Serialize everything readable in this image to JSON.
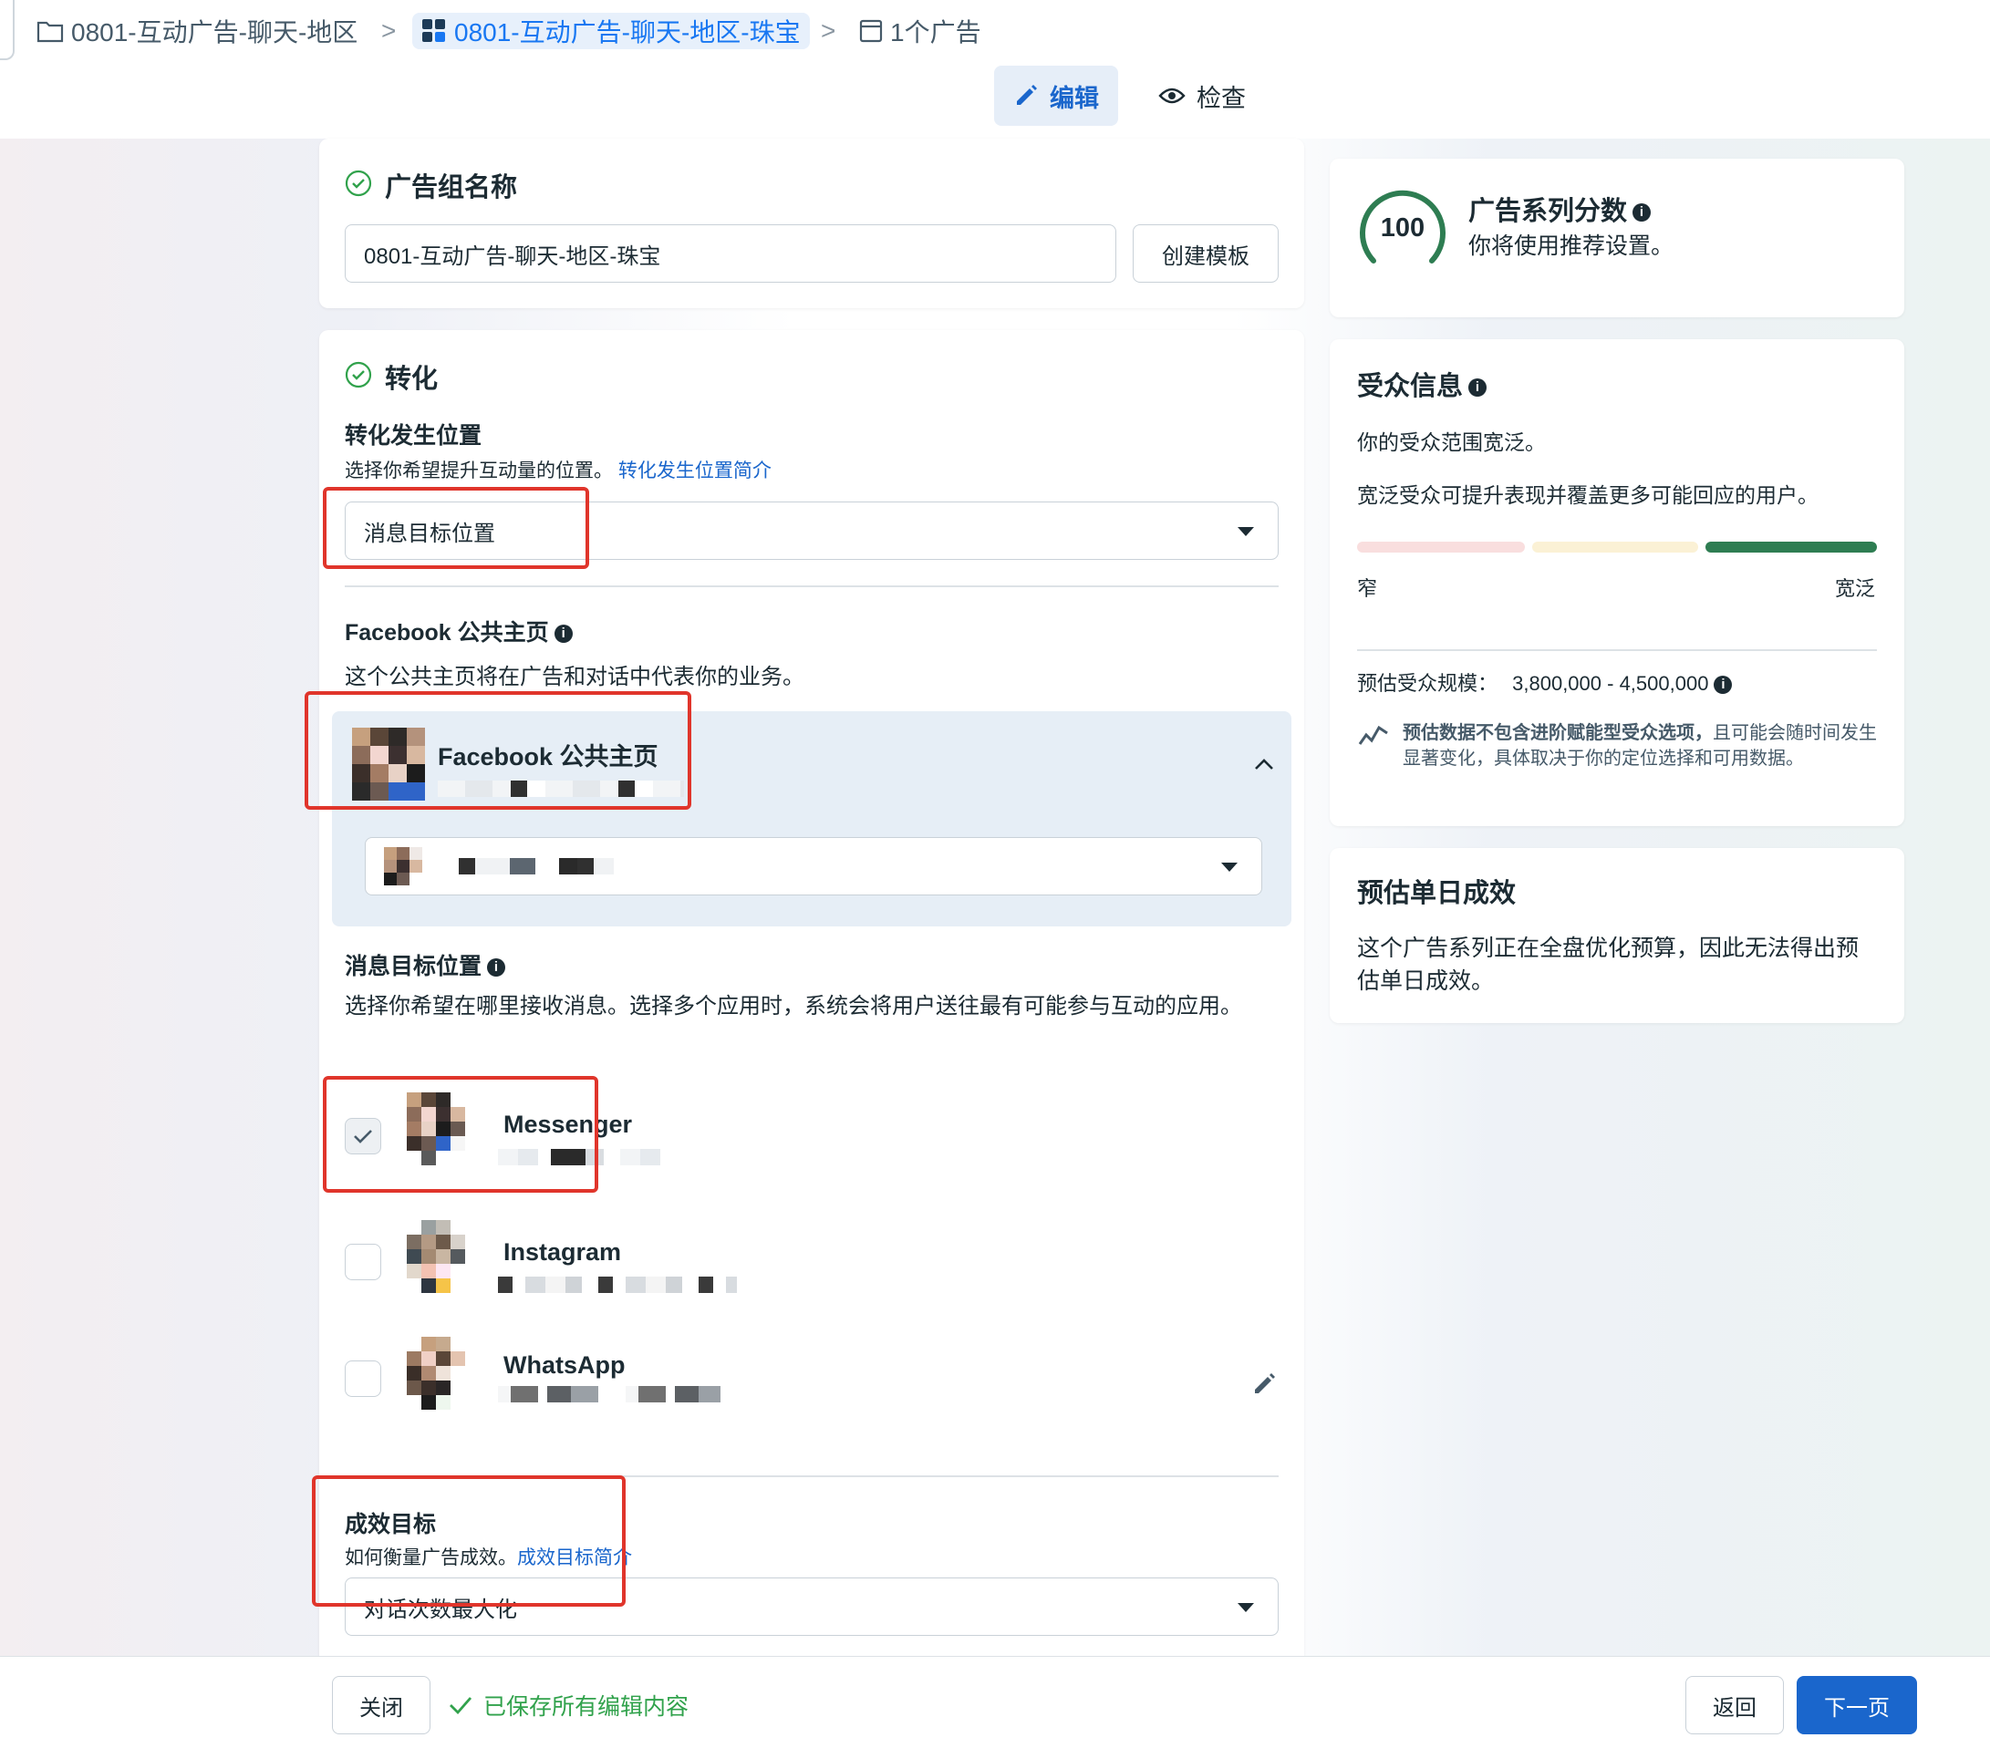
{
  "breadcrumb": {
    "campaign": "0801-互动广告-聊天-地区",
    "adset": "0801-互动广告-聊天-地区-珠宝",
    "ads": "1个广告"
  },
  "mode_tabs": {
    "edit": "编辑",
    "review": "检查"
  },
  "adset_name": {
    "title": "广告组名称",
    "value": "0801-互动广告-聊天-地区-珠宝",
    "template_button": "创建模板"
  },
  "conversion": {
    "title": "转化",
    "location_label": "转化发生位置",
    "location_hint": "选择你希望提升互动量的位置。",
    "location_link": "转化发生位置简介",
    "location_value": "消息目标位置",
    "page_label": "Facebook 公共主页",
    "page_hint": "这个公共主页将在广告和对话中代表你的业务。",
    "page_card_title": "Facebook 公共主页",
    "destinations_label": "消息目标位置",
    "destinations_hint": "选择你希望在哪里接收消息。选择多个应用时，系统会将用户送往最有可能参与互动的应用。",
    "apps": [
      {
        "name": "Messenger",
        "checked": true
      },
      {
        "name": "Instagram",
        "checked": false
      },
      {
        "name": "WhatsApp",
        "checked": false
      }
    ],
    "goal_label": "成效目标",
    "goal_hint": "如何衡量广告成效。",
    "goal_link": "成效目标简介",
    "goal_value": "对话次数最大化"
  },
  "campaign_score": {
    "score": "100",
    "title": "广告系列分数",
    "desc": "你将使用推荐设置。",
    "color": "#31a24c"
  },
  "audience": {
    "title": "受众信息",
    "line1": "你的受众范围宽泛。",
    "line2": "宽泛受众可提升表现并覆盖更多可能回应的用户。",
    "narrow": "窄",
    "broad": "宽泛",
    "size_label": "预估受众规模：",
    "size_value": "3,800,000 - 4,500,000",
    "note_bold": "预估数据不包含进阶赋能型受众选项，",
    "note_rest": "且可能会随时间发生显著变化，具体取决于你的定位选择和可用数据。",
    "meter_colors": [
      "#f9dede",
      "#fbf1d5",
      "#2e7d52"
    ]
  },
  "daily_results": {
    "title": "预估单日成效",
    "desc": "这个广告系列正在全盘优化预算，因此无法得出预估单日成效。"
  },
  "footer": {
    "close": "关闭",
    "saved": "已保存所有编辑内容",
    "back": "返回",
    "next": "下一页"
  }
}
